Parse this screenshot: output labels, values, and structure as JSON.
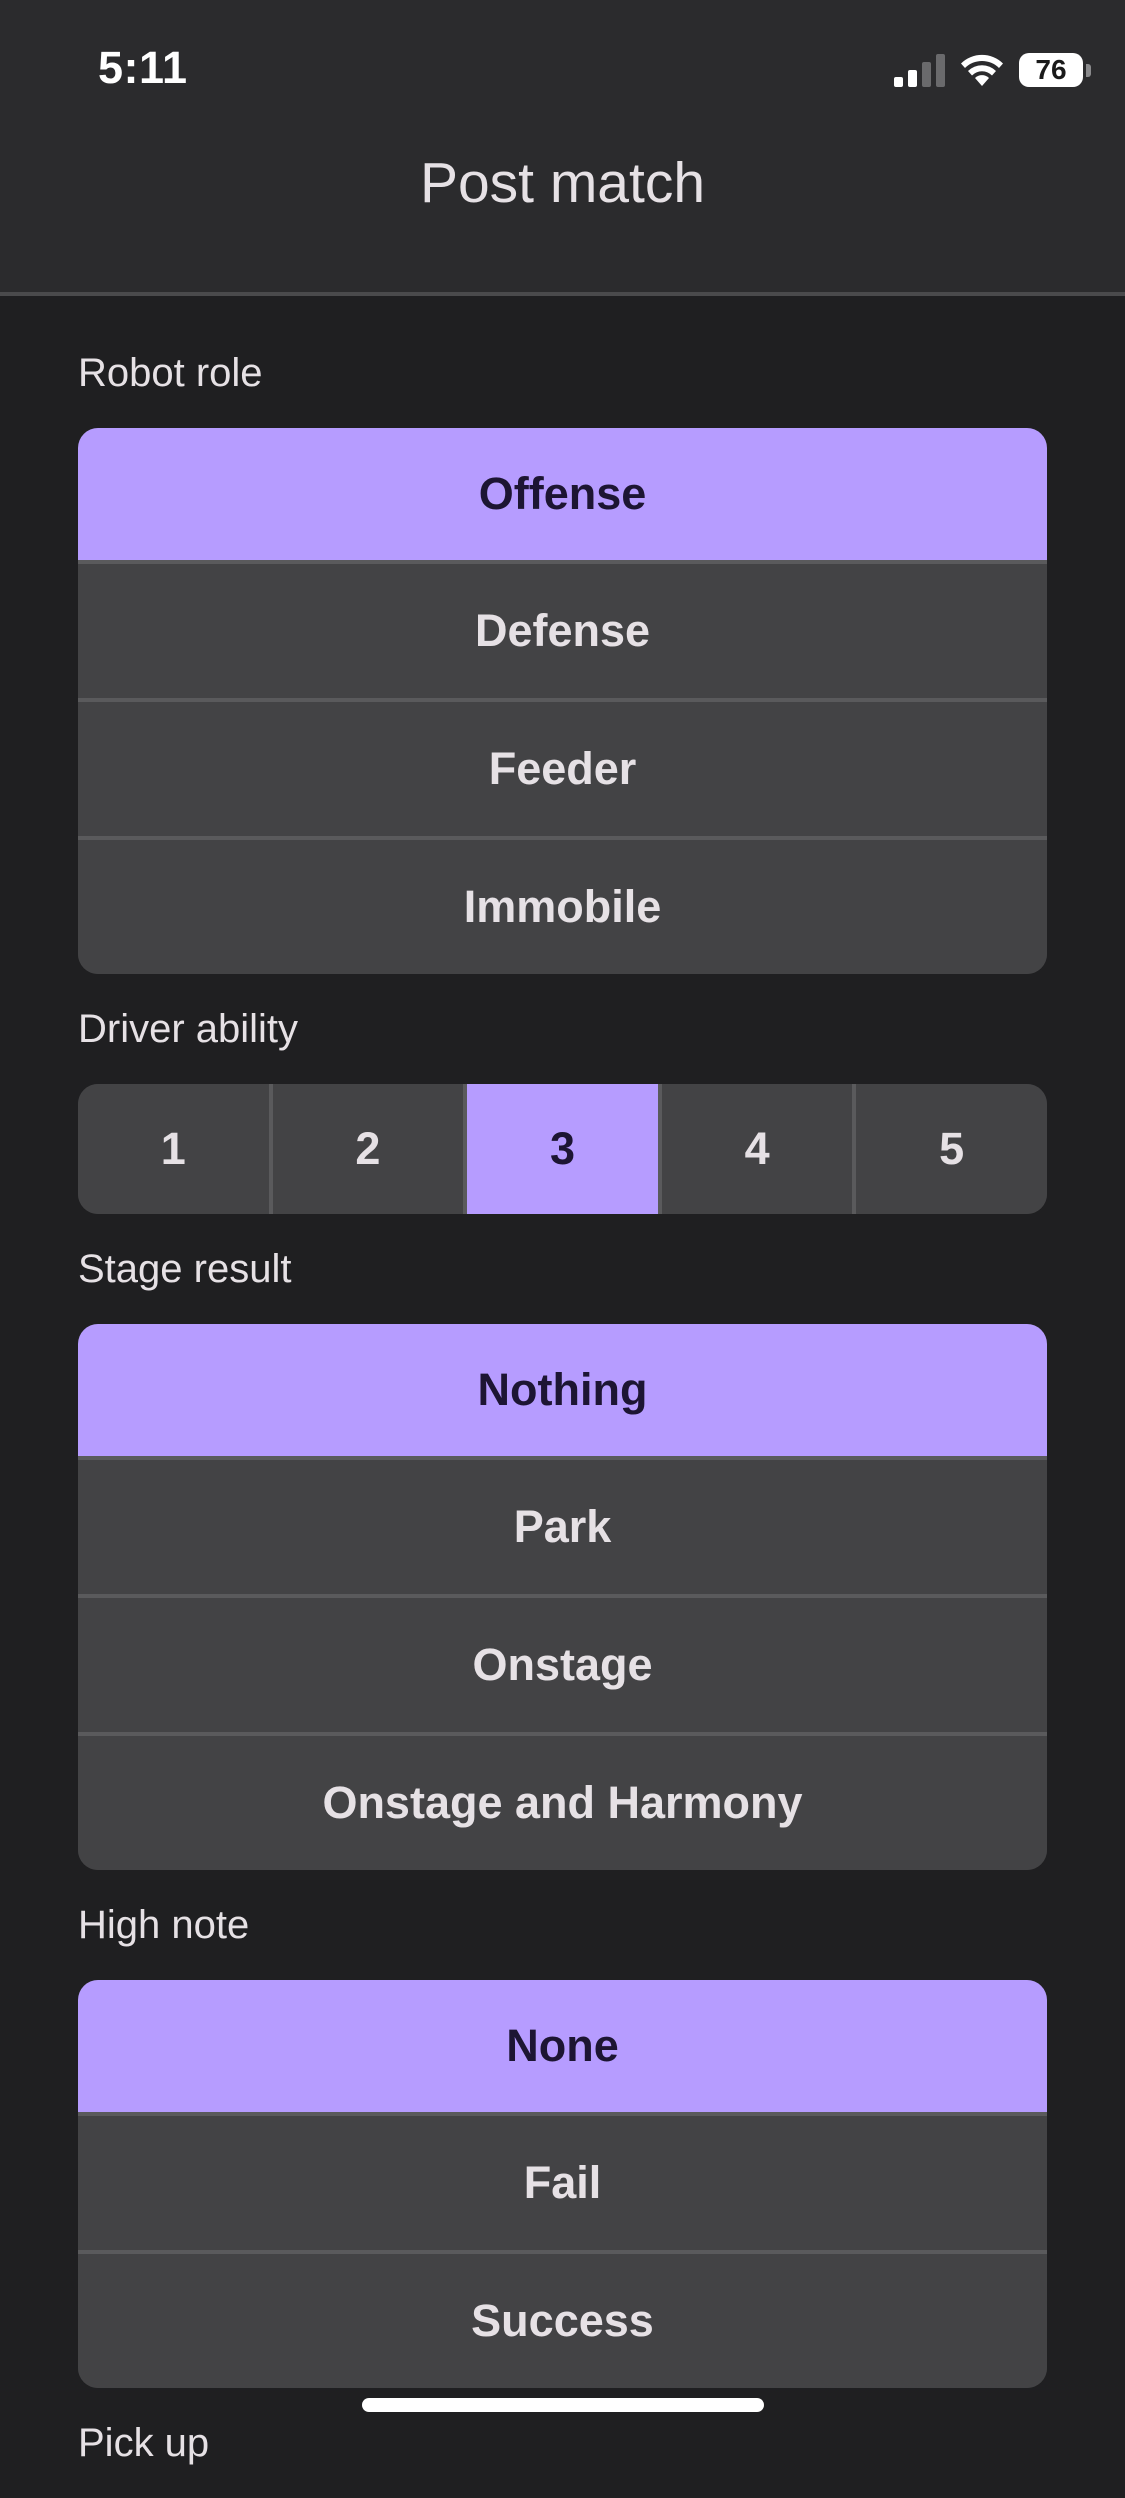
{
  "status_bar": {
    "time": "5:11",
    "battery": "76",
    "icons": [
      "cellular-signal-icon",
      "wifi-icon",
      "battery-icon"
    ]
  },
  "header": {
    "title": "Post match"
  },
  "colors": {
    "background": "#1f1f21",
    "header": "#2b2b2d",
    "option": "#434345",
    "selected": "#b69cff",
    "selected_text": "#1d1533"
  },
  "robot_role": {
    "label": "Robot role",
    "options": [
      "Offense",
      "Defense",
      "Feeder",
      "Immobile"
    ],
    "selected": "Offense"
  },
  "driver_ability": {
    "label": "Driver ability",
    "options": [
      "1",
      "2",
      "3",
      "4",
      "5"
    ],
    "selected": "3"
  },
  "stage_result": {
    "label": "Stage result",
    "options": [
      "Nothing",
      "Park",
      "Onstage",
      "Onstage and Harmony"
    ],
    "selected": "Nothing"
  },
  "high_note": {
    "label": "High note",
    "options": [
      "None",
      "Fail",
      "Success"
    ],
    "selected": "None"
  },
  "pick_up": {
    "label": "Pick up"
  }
}
